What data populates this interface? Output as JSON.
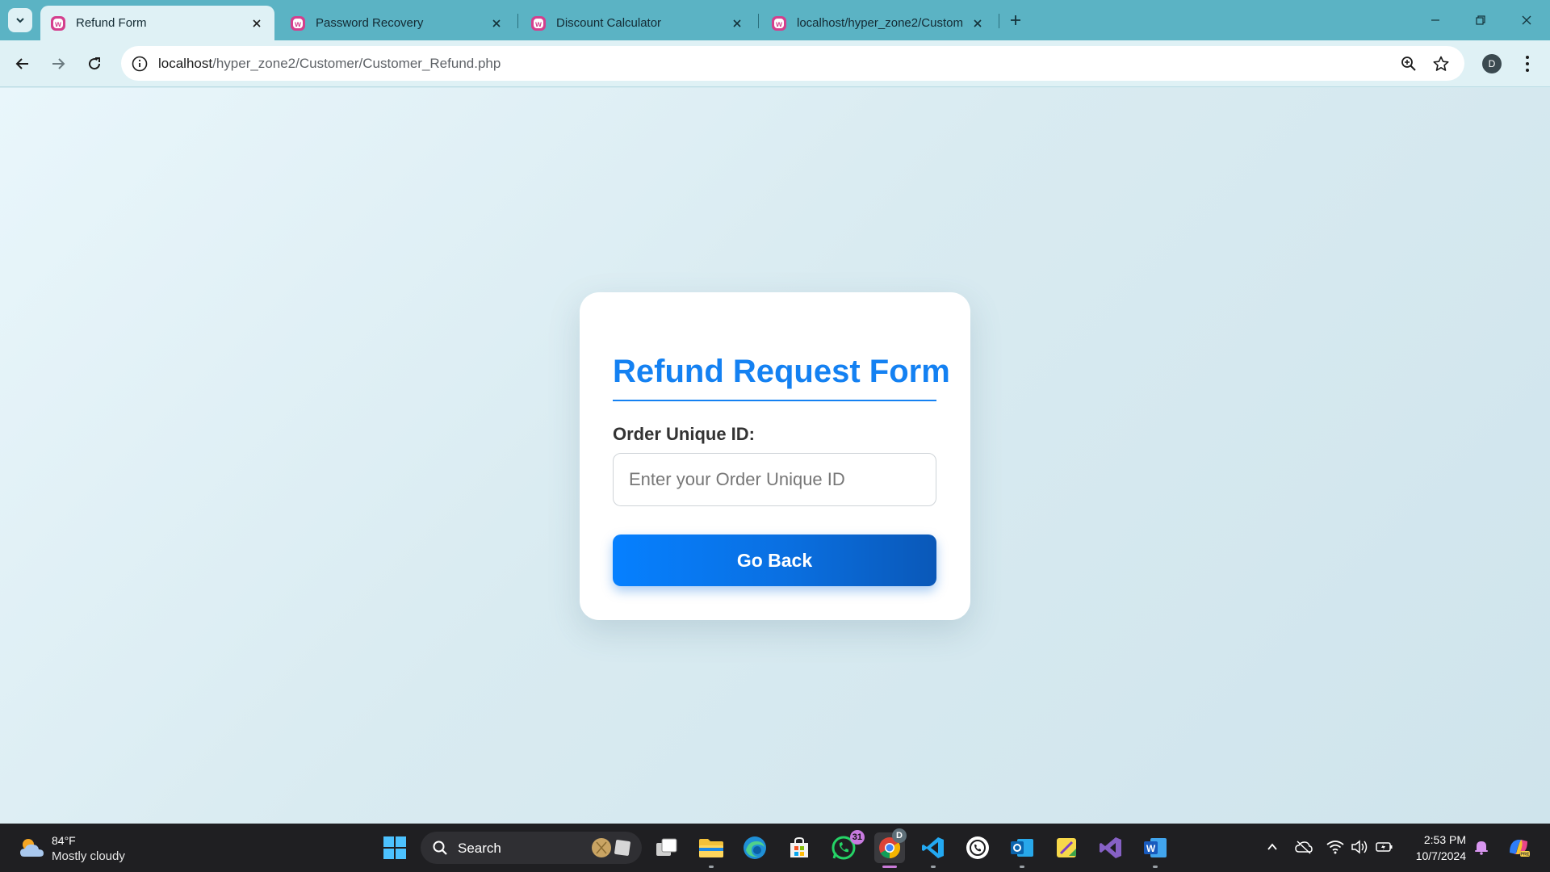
{
  "browser": {
    "tabs": [
      {
        "title": "Refund Form",
        "active": true
      },
      {
        "title": "Password Recovery",
        "active": false
      },
      {
        "title": "Discount Calculator",
        "active": false
      },
      {
        "title": "localhost/hyper_zone2/Custom",
        "active": false
      }
    ],
    "url_host": "localhost",
    "url_path": "/hyper_zone2/Customer/Customer_Refund.php",
    "profile_initial": "D",
    "accent_color": "#5bb3c4",
    "favicon_color": "#d43f8d"
  },
  "form": {
    "title": "Refund Request Form",
    "order_label": "Order Unique ID:",
    "order_placeholder": "Enter your Order Unique ID",
    "order_value": "",
    "go_back_label": "Go Back",
    "title_color": "#1481f2",
    "button_color": "#0680ff"
  },
  "taskbar": {
    "weather_temp": "84°F",
    "weather_condition": "Mostly cloudy",
    "search_label": "Search",
    "whatsapp_badge": "31",
    "chrome_badge": "D",
    "time": "2:53 PM",
    "date": "10/7/2024",
    "apps": [
      "windows-start-icon",
      "task-view-icon",
      "file-explorer-icon",
      "edge-icon",
      "store-icon",
      "whatsapp-icon",
      "chrome-icon",
      "vscode-icon",
      "whatsapp-desktop-icon",
      "outlook-icon",
      "sticky-notes-icon",
      "visual-studio-icon",
      "word-icon"
    ],
    "tray": [
      "chevron-up-icon",
      "onedrive-icon",
      "wifi-icon",
      "volume-icon",
      "battery-icon",
      "notification-bell-icon",
      "copilot-icon"
    ]
  }
}
